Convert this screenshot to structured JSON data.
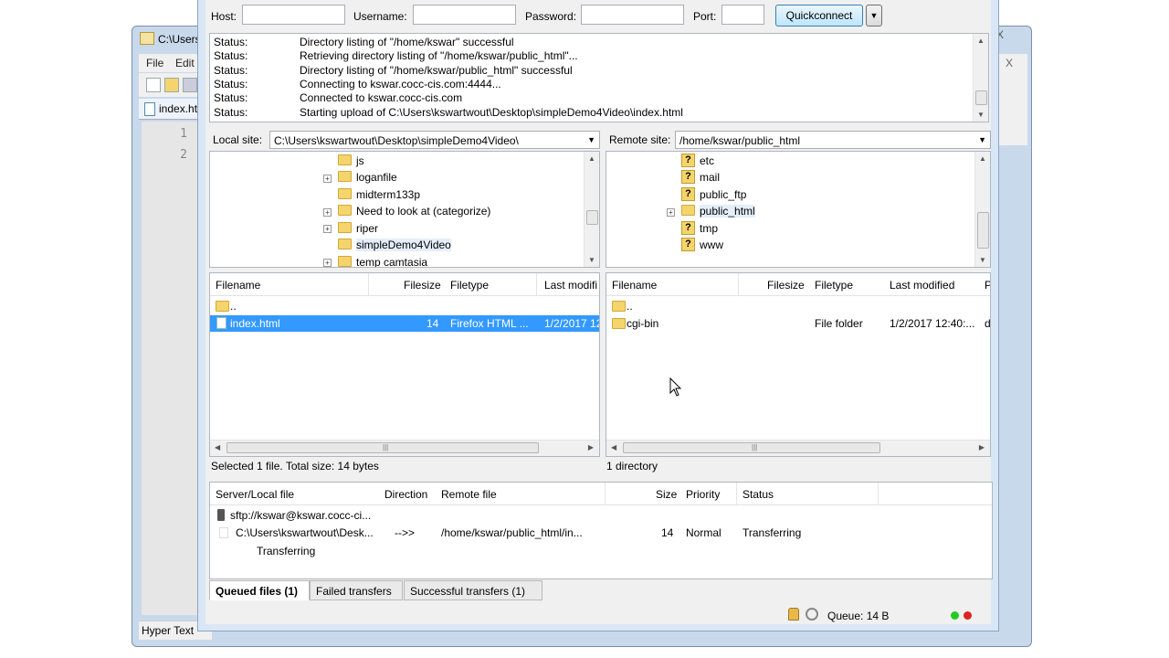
{
  "background_window": {
    "title": "C:\\Users",
    "menu": [
      "File",
      "Edit"
    ],
    "tab_label": "index.htm",
    "line_numbers": [
      "1",
      "2"
    ],
    "status_text": "Hyper Text",
    "close_glyph": "X",
    "right_close": "X"
  },
  "quickconnect": {
    "host_label": "Host:",
    "host_value": "",
    "username_label": "Username:",
    "username_value": "",
    "password_label": "Password:",
    "password_value": "",
    "port_label": "Port:",
    "port_value": "",
    "button_label": "Quickconnect"
  },
  "log": [
    {
      "key": "Status:",
      "text": "Directory listing of \"/home/kswar\" successful"
    },
    {
      "key": "Status:",
      "text": "Retrieving directory listing of \"/home/kswar/public_html\"..."
    },
    {
      "key": "Status:",
      "text": "Directory listing of \"/home/kswar/public_html\" successful"
    },
    {
      "key": "Status:",
      "text": "Connecting to kswar.cocc-cis.com:4444..."
    },
    {
      "key": "Status:",
      "text": "Connected to kswar.cocc-cis.com"
    },
    {
      "key": "Status:",
      "text": "Starting upload of C:\\Users\\kswartwout\\Desktop\\simpleDemo4Video\\index.html"
    }
  ],
  "local": {
    "label": "Local site:",
    "path": "C:\\Users\\kswartwout\\Desktop\\simpleDemo4Video\\",
    "tree": [
      "js",
      "loganfile",
      "midterm133p",
      "Need to look at (categorize)",
      "riper",
      "simpleDemo4Video",
      "temp camtasia"
    ],
    "columns": {
      "filename": "Filename",
      "filesize": "Filesize",
      "filetype": "Filetype",
      "modified": "Last modifi"
    },
    "files": [
      {
        "name": "..",
        "size": "",
        "type": "",
        "modified": ""
      },
      {
        "name": "index.html",
        "size": "14",
        "type": "Firefox HTML ...",
        "modified": "1/2/2017 12:"
      }
    ],
    "status": "Selected 1 file. Total size: 14 bytes"
  },
  "remote": {
    "label": "Remote site:",
    "path": "/home/kswar/public_html",
    "tree": [
      "etc",
      "mail",
      "public_ftp",
      "public_html",
      "tmp",
      "www"
    ],
    "columns": {
      "filename": "Filename",
      "filesize": "Filesize",
      "filetype": "Filetype",
      "modified": "Last modified",
      "perm": "P"
    },
    "files": [
      {
        "name": "..",
        "size": "",
        "type": "",
        "modified": "",
        "perm": ""
      },
      {
        "name": "cgi-bin",
        "size": "",
        "type": "File folder",
        "modified": "1/2/2017 12:40:...",
        "perm": "d"
      }
    ],
    "status": "1 directory"
  },
  "queue": {
    "columns": {
      "server": "Server/Local file",
      "direction": "Direction",
      "remote": "Remote file",
      "size": "Size",
      "priority": "Priority",
      "status": "Status"
    },
    "server": "sftp://kswar@kswar.cocc-ci...",
    "local_file": "C:\\Users\\kswartwout\\Desk...",
    "direction": "-->>",
    "remote_file": "/home/kswar/public_html/in...",
    "size": "14",
    "priority": "Normal",
    "status": "Transferring",
    "progress_text": "Transferring"
  },
  "tabs": {
    "queued": "Queued files (1)",
    "failed": "Failed transfers",
    "successful": "Successful transfers (1)"
  },
  "statusbar": {
    "queue_text": "Queue: 14 B"
  },
  "colors": {
    "selection": "#3399ff",
    "led_green": "#22cc22",
    "led_red": "#dd2222"
  }
}
